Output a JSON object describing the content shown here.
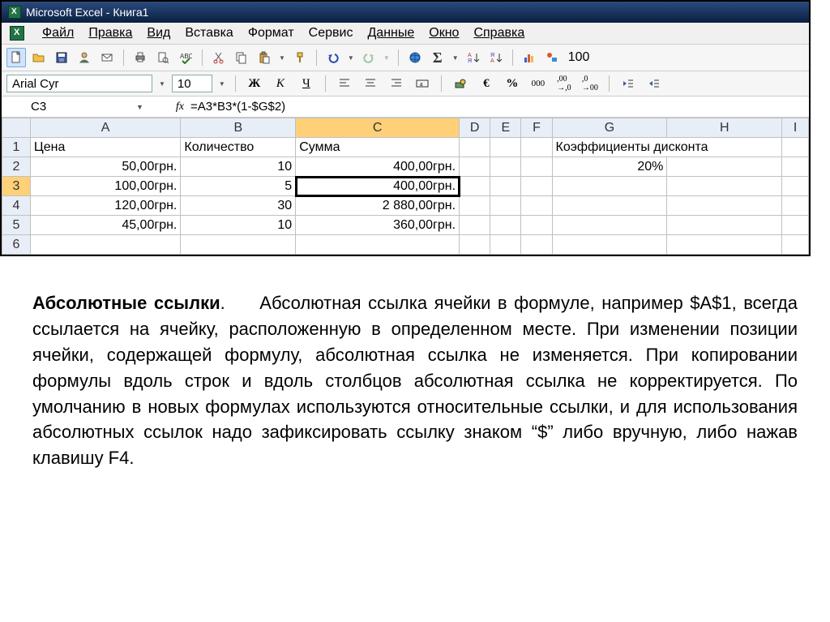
{
  "window": {
    "title": "Microsoft Excel - Книга1"
  },
  "menu": {
    "file": "Файл",
    "edit": "Правка",
    "view": "Вид",
    "insert": "Вставка",
    "format": "Формат",
    "tools": "Сервис",
    "data": "Данные",
    "window": "Окно",
    "help": "Справка"
  },
  "format_bar": {
    "font": "Arial Cyr",
    "size": "10",
    "bold": "Ж",
    "italic": "К",
    "underline": "Ч",
    "currency": "€",
    "percent": "%",
    "thousands": "000"
  },
  "toolbar": {
    "zoom": "100"
  },
  "formula": {
    "cell_ref": "C3",
    "fx": "fx",
    "text": "=A3*B3*(1-$G$2)"
  },
  "columns": [
    "A",
    "B",
    "C",
    "D",
    "E",
    "F",
    "G",
    "H",
    "I"
  ],
  "headers": {
    "A": "Цена",
    "B": "Количество",
    "C": "Сумма",
    "G": "Коэффициенты дисконта"
  },
  "rows": [
    {
      "n": "1"
    },
    {
      "n": "2",
      "A": "50,00грн.",
      "B": "10",
      "C": "400,00грн.",
      "G": "20%"
    },
    {
      "n": "3",
      "A": "100,00грн.",
      "B": "5",
      "C": "400,00грн."
    },
    {
      "n": "4",
      "A": "120,00грн.",
      "B": "30",
      "C": "2 880,00грн."
    },
    {
      "n": "5",
      "A": "45,00грн.",
      "B": "10",
      "C": "360,00грн."
    },
    {
      "n": "6"
    }
  ],
  "selected": {
    "cell": "C3",
    "row": "3",
    "col": "C"
  },
  "article": {
    "title": "Абсолютные ссылки",
    "body": "Абсолютная ссылка ячейки в формуле, например $A$1, всегда ссылается на ячейку, расположенную в определенном месте. При изменении позиции ячейки, содержащей формулу, абсолютная ссылка не изменяется. При копировании формулы вдоль строк и вдоль столбцов абсолютная ссылка не корректируется. По умолчанию в новых формулах используются относительные ссылки, и для использования абсолютных ссылок надо зафиксировать ссылку знаком “$” либо вручную, либо нажав клавишу F4."
  }
}
